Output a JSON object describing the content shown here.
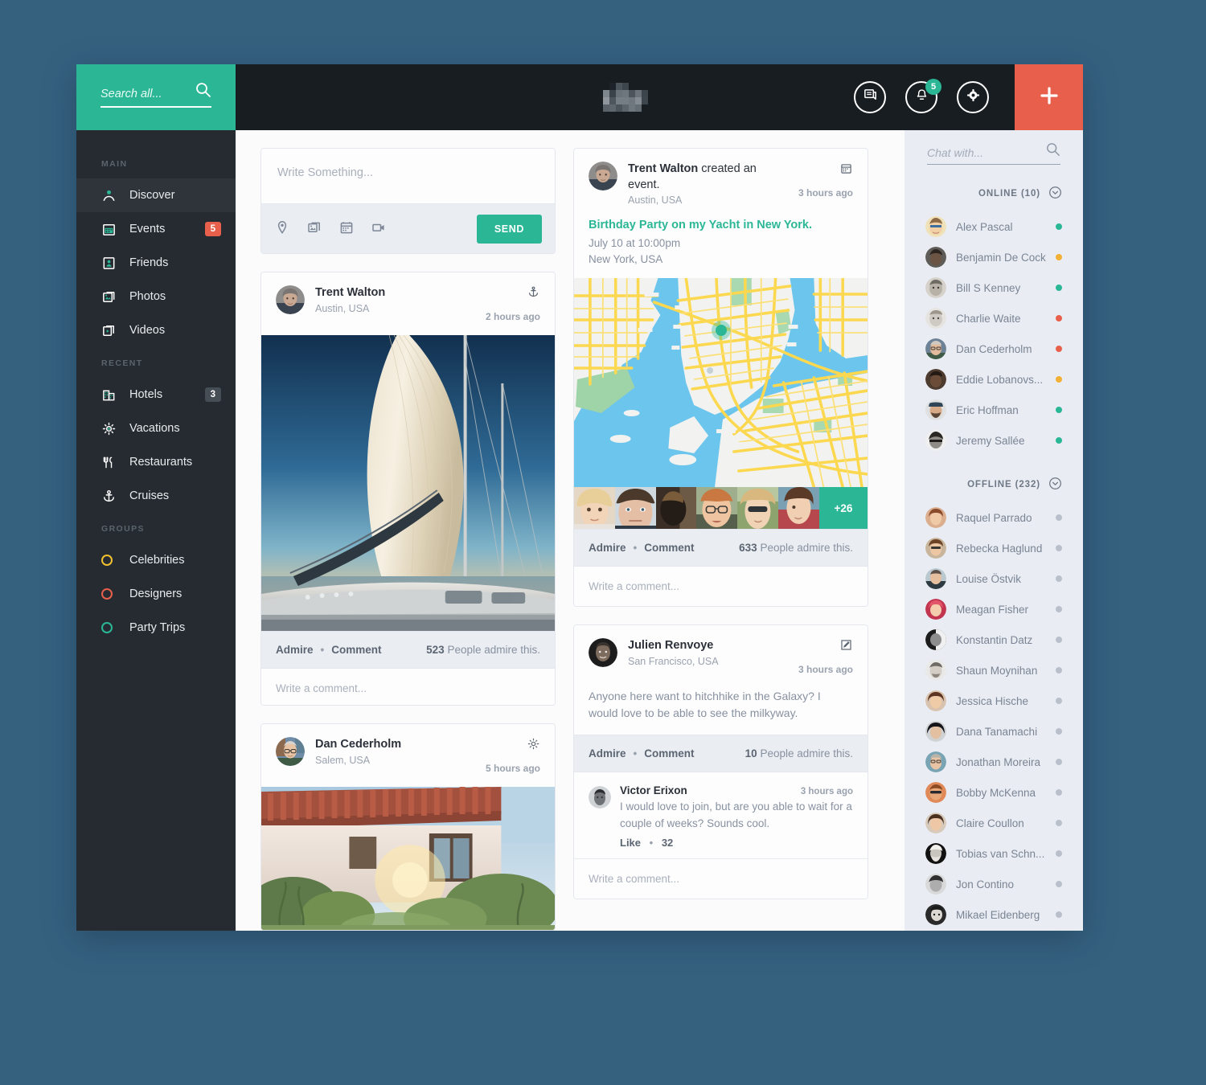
{
  "colors": {
    "brand_green": "#2bb796",
    "accent_orange": "#e8604c",
    "dark_nav": "#252b31",
    "topbar_dark": "#171d21",
    "chat_bg": "#e9edf3",
    "status_online": "#2bb796",
    "status_away": "#f2b134",
    "status_busy": "#e8604c",
    "status_offline": "#b9c0cb"
  },
  "search": {
    "placeholder": "Search all...",
    "value": "",
    "icon": "search-icon"
  },
  "topbar": {
    "logo": "logo-pixelated",
    "messages_icon": "messages-icon",
    "notifications_icon": "bell-icon",
    "notifications_count": "5",
    "settings_icon": "gear-icon",
    "add_icon": "plus-icon"
  },
  "sidebar": {
    "sections": [
      {
        "title": "MAIN",
        "items": [
          {
            "label": "Discover",
            "icon": "discover-pin-icon",
            "badge": null,
            "active": true
          },
          {
            "label": "Events",
            "icon": "calendar-icon",
            "badge": "5",
            "badge_style": "red",
            "active": false
          },
          {
            "label": "Friends",
            "icon": "friends-icon",
            "badge": null,
            "active": false
          },
          {
            "label": "Photos",
            "icon": "photos-icon",
            "badge": null,
            "active": false
          },
          {
            "label": "Videos",
            "icon": "videos-icon",
            "badge": null,
            "active": false
          }
        ]
      },
      {
        "title": "RECENT",
        "items": [
          {
            "label": "Hotels",
            "icon": "hotel-icon",
            "badge": "3",
            "badge_style": "grey",
            "active": false
          },
          {
            "label": "Vacations",
            "icon": "sun-icon",
            "badge": null,
            "active": false
          },
          {
            "label": "Restaurants",
            "icon": "cutlery-icon",
            "badge": null,
            "active": false
          },
          {
            "label": "Cruises",
            "icon": "anchor-icon",
            "badge": null,
            "active": false
          }
        ]
      },
      {
        "title": "GROUPS",
        "items": [
          {
            "label": "Celebrities",
            "icon": "ring-icon",
            "ring_color": "#f2c12e",
            "badge": null,
            "active": false
          },
          {
            "label": "Designers",
            "icon": "ring-icon",
            "ring_color": "#e8604c",
            "badge": null,
            "active": false
          },
          {
            "label": "Party Trips",
            "icon": "ring-icon",
            "ring_color": "#2bb796",
            "badge": null,
            "active": false
          }
        ]
      }
    ]
  },
  "composer": {
    "placeholder": "Write Something...",
    "value": "",
    "tools": [
      "location-icon",
      "photo-icon",
      "calendar-icon",
      "video-icon"
    ],
    "send_label": "SEND"
  },
  "posts": [
    {
      "id": "post-trent-yacht-photo",
      "author": "Trent Walton",
      "location": "Austin, USA",
      "time": "2 hours ago",
      "type_icon": "anchor-icon",
      "media": "yacht-sail-photo",
      "admire_label": "Admire",
      "comment_label": "Comment",
      "admire_count": "523",
      "admire_suffix": "People admire this.",
      "comment_placeholder": "Write a comment..."
    },
    {
      "id": "post-dan-cederholm",
      "author": "Dan Cederholm",
      "location": "Salem, USA",
      "time": "5 hours ago",
      "type_icon": "sun-icon",
      "media": "villa-garden-photo"
    }
  ],
  "event_post": {
    "id": "post-trent-event",
    "author": "Trent Walton",
    "action": "created an event.",
    "location": "Austin, USA",
    "time": "3 hours ago",
    "type_icon": "calendar-icon",
    "title": "Birthday Party on my Yacht in New York.",
    "date": "July 10 at 10:00pm",
    "place": "New York, USA",
    "map": "new-york-map",
    "attendees_overflow": "+26",
    "admire_label": "Admire",
    "comment_label": "Comment",
    "admire_count": "633",
    "admire_suffix": "People admire this.",
    "comment_placeholder": "Write a comment..."
  },
  "status_post": {
    "id": "post-julien-renvoye",
    "author": "Julien Renvoye",
    "location": "San Francisco, USA",
    "time": "3 hours ago",
    "type_icon": "edit-icon",
    "text": "Anyone here want to hitchhike in the Galaxy? I would love to be able to see the milkyway.",
    "admire_label": "Admire",
    "comment_label": "Comment",
    "admire_count": "10",
    "admire_suffix": "People admire this.",
    "comment_placeholder": "Write a comment...",
    "comment": {
      "author": "Victor Erixon",
      "time": "3 hours ago",
      "text": "I would love to join, but are you able to wait for a couple of weeks? Sounds cool.",
      "like_label": "Like",
      "like_count": "32"
    }
  },
  "chat": {
    "search_placeholder": "Chat with...",
    "search_value": "",
    "online_label": "ONLINE (10)",
    "offline_label": "OFFLINE (232)",
    "chevron_icon": "chevron-down-icon",
    "online": [
      {
        "name": "Alex Pascal",
        "status": "online"
      },
      {
        "name": "Benjamin De Cock",
        "status": "away"
      },
      {
        "name": "Bill S Kenney",
        "status": "online"
      },
      {
        "name": "Charlie Waite",
        "status": "busy"
      },
      {
        "name": "Dan Cederholm",
        "status": "busy"
      },
      {
        "name": "Eddie Lobanovs...",
        "status": "away"
      },
      {
        "name": "Eric Hoffman",
        "status": "online"
      },
      {
        "name": "Jeremy Sallée",
        "status": "online"
      }
    ],
    "offline": [
      {
        "name": "Raquel Parrado",
        "status": "offline"
      },
      {
        "name": "Rebecka Haglund",
        "status": "offline"
      },
      {
        "name": "Louise Östvik",
        "status": "offline"
      },
      {
        "name": "Meagan Fisher",
        "status": "offline"
      },
      {
        "name": "Konstantin Datz",
        "status": "offline"
      },
      {
        "name": "Shaun Moynihan",
        "status": "offline"
      },
      {
        "name": "Jessica Hische",
        "status": "offline"
      },
      {
        "name": "Dana Tanamachi",
        "status": "offline"
      },
      {
        "name": "Jonathan Moreira",
        "status": "offline"
      },
      {
        "name": "Bobby McKenna",
        "status": "offline"
      },
      {
        "name": "Claire Coullon",
        "status": "offline"
      },
      {
        "name": "Tobias van Schn...",
        "status": "offline"
      },
      {
        "name": "Jon Contino",
        "status": "offline"
      },
      {
        "name": "Mikael Eidenberg",
        "status": "offline"
      }
    ]
  }
}
